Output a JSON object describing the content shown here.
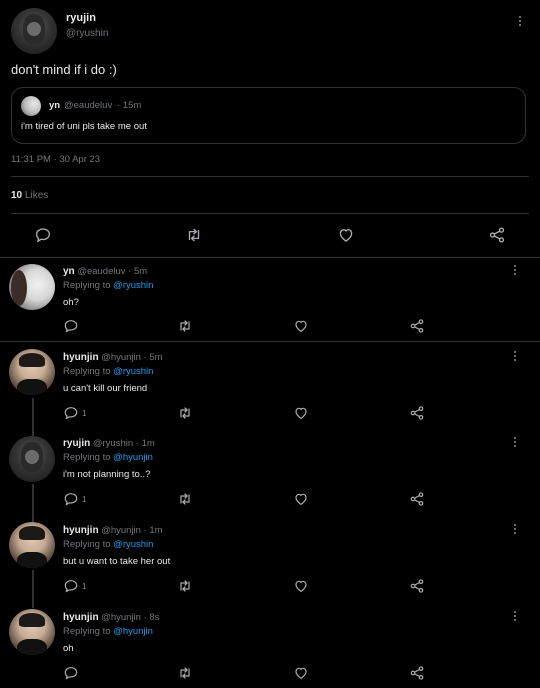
{
  "main_tweet": {
    "display_name": "ryujin",
    "handle": "@ryushin",
    "text": "don't mind if i do :)",
    "timestamp": "11:31 PM · 30 Apr 23",
    "likes_count": "10",
    "likes_label": "Likes"
  },
  "quoted_tweet": {
    "display_name": "yn",
    "handle": "@eaudeluv",
    "time": "· 15m",
    "text": "i'm tired of uni pls take me out"
  },
  "replies": [
    {
      "display_name": "yn",
      "handle": "@eaudeluv",
      "time": "· 5m",
      "replying_prefix": "Replying to",
      "replying_to": "@ryushin",
      "text": "oh?",
      "reply_count": ""
    },
    {
      "display_name": "hyunjin",
      "handle": "@hyunjin",
      "time": "· 5m",
      "replying_prefix": "Replying to",
      "replying_to": "@ryushin",
      "text": "u can't kill our friend",
      "reply_count": "1"
    },
    {
      "display_name": "ryujin",
      "handle": "@ryushin",
      "time": "· 1m",
      "replying_prefix": "Replying to",
      "replying_to": "@hyunjin",
      "text": "i'm not planning to..?",
      "reply_count": "1"
    },
    {
      "display_name": "hyunjin",
      "handle": "@hyunjin",
      "time": "· 1m",
      "replying_prefix": "Replying to",
      "replying_to": "@ryushin",
      "text": "but u want to take her out",
      "reply_count": "1"
    },
    {
      "display_name": "hyunjin",
      "handle": "@hyunjin",
      "time": "· 8s",
      "replying_prefix": "Replying to",
      "replying_to": "@hyunjin",
      "text": "oh",
      "reply_count": ""
    }
  ],
  "icons": {
    "reply": "speech-bubble-icon",
    "retweet": "retweet-icon",
    "like": "heart-icon",
    "share": "share-icon",
    "more": "more-vertical-icon"
  },
  "colors": {
    "background": "#000000",
    "text": "#e7e9ea",
    "muted": "#71767b",
    "accent": "#1d9bf0",
    "border": "#2f3336"
  }
}
